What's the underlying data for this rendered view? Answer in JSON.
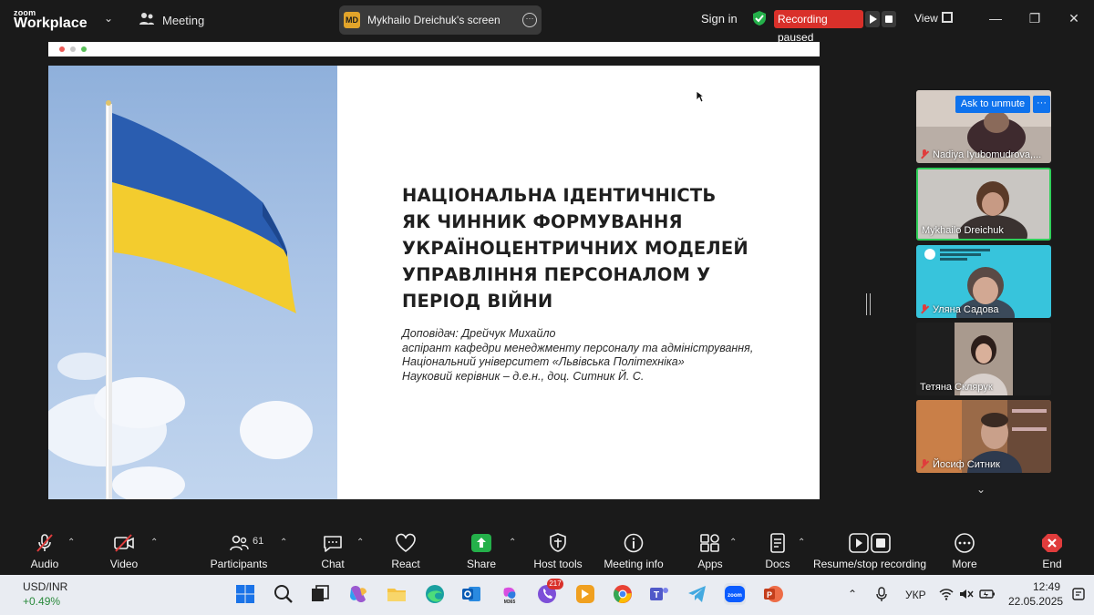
{
  "app": {
    "brand_small": "zoom",
    "brand_big": "Workplace",
    "meeting_label": "Meeting",
    "share_badge": "MD",
    "share_label": "Mykhailo Dreichuk's screen",
    "sign_in": "Sign in",
    "recording_status": "Recording paused",
    "view_label": "View"
  },
  "slide": {
    "title_lines": [
      "НАЦІОНАЛЬНА ІДЕНТИЧНІСТЬ",
      "ЯК ЧИННИК ФОРМУВАННЯ",
      "УКРАЇНОЦЕНТРИЧНИХ МОДЕЛЕЙ",
      "УПРАВЛІННЯ ПЕРСОНАЛОМ У",
      "ПЕРІОД ВІЙНИ"
    ],
    "text_lines": [
      "Доповідач: Дрейчук Михайло",
      "аспірант кафедри менеджменту персоналу та адміністрування,",
      "Національний університет «Львівська Політехніка»",
      "Науковий керівник – д.е.н., доц. Ситник Й. С."
    ]
  },
  "participants": [
    {
      "name": "Nadiya Iyubomudrova,...",
      "muted": true,
      "ask_unmute": "Ask to unmute",
      "more": "···"
    },
    {
      "name": "Mykhailo Dreichuk",
      "muted": false,
      "active": true
    },
    {
      "name": "Уляна Садова",
      "muted": true
    },
    {
      "name": "Тетяна  Склярук",
      "muted": false
    },
    {
      "name": "Йосиф Ситник",
      "muted": true
    }
  ],
  "toolbar": {
    "audio": "Audio",
    "video": "Video",
    "participants": "Participants",
    "participants_count": "61",
    "chat": "Chat",
    "react": "React",
    "share": "Share",
    "host_tools": "Host tools",
    "meeting_info": "Meeting info",
    "apps": "Apps",
    "docs": "Docs",
    "recording": "Resume/stop recording",
    "more": "More",
    "end": "End"
  },
  "taskbar": {
    "ticker_name": "USD/INR",
    "ticker_value": "+0.49%",
    "viber_badge": "217",
    "language": "УКР",
    "time": "12:49",
    "date": "22.05.2025"
  },
  "colors": {
    "accent": "#0e72ed",
    "recording": "#d9302a",
    "active_border": "#2fd05a",
    "share_green": "#24b04a"
  }
}
